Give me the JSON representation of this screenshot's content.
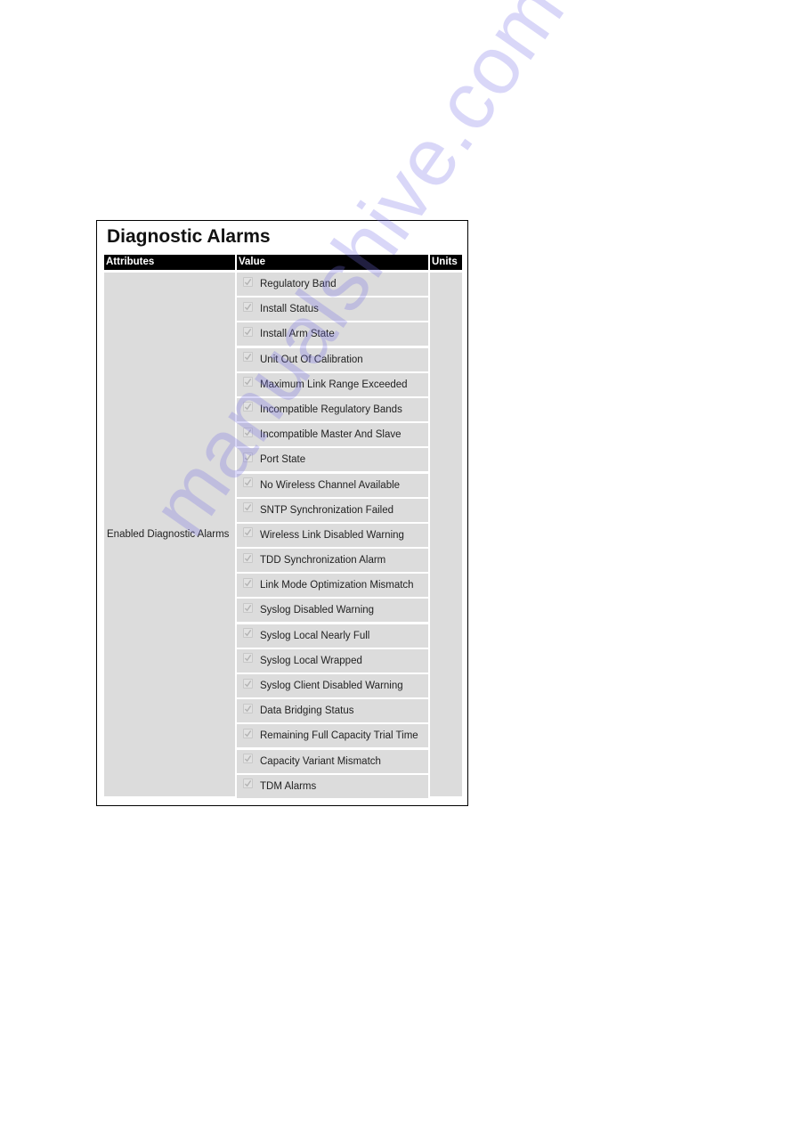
{
  "panel": {
    "title": "Diagnostic Alarms",
    "columns": {
      "attributes": "Attributes",
      "value": "Value",
      "units": "Units"
    },
    "attribute_label": "Enabled Diagnostic Alarms",
    "alarms": [
      {
        "label": "Regulatory Band",
        "checked": true,
        "disabled": true
      },
      {
        "label": "Install Status",
        "checked": true,
        "disabled": true
      },
      {
        "label": "Install Arm State",
        "checked": true,
        "disabled": true
      },
      {
        "label": "Unit Out Of Calibration",
        "checked": true,
        "disabled": true
      },
      {
        "label": "Maximum Link Range Exceeded",
        "checked": true,
        "disabled": true
      },
      {
        "label": "Incompatible Regulatory Bands",
        "checked": true,
        "disabled": true
      },
      {
        "label": "Incompatible Master And Slave",
        "checked": true,
        "disabled": true
      },
      {
        "label": "Port State",
        "checked": true,
        "disabled": true
      },
      {
        "label": "No Wireless Channel Available",
        "checked": true,
        "disabled": true
      },
      {
        "label": "SNTP Synchronization Failed",
        "checked": true,
        "disabled": true
      },
      {
        "label": "Wireless Link Disabled Warning",
        "checked": true,
        "disabled": true
      },
      {
        "label": "TDD Synchronization Alarm",
        "checked": true,
        "disabled": true
      },
      {
        "label": "Link Mode Optimization Mismatch",
        "checked": true,
        "disabled": true
      },
      {
        "label": "Syslog Disabled Warning",
        "checked": true,
        "disabled": true
      },
      {
        "label": "Syslog Local Nearly Full",
        "checked": true,
        "disabled": true
      },
      {
        "label": "Syslog Local Wrapped",
        "checked": true,
        "disabled": true
      },
      {
        "label": "Syslog Client Disabled Warning",
        "checked": true,
        "disabled": true
      },
      {
        "label": "Data Bridging Status",
        "checked": true,
        "disabled": true
      },
      {
        "label": "Remaining Full Capacity Trial Time",
        "checked": true,
        "disabled": true
      },
      {
        "label": "Capacity Variant Mismatch",
        "checked": true,
        "disabled": true
      },
      {
        "label": "TDM Alarms",
        "checked": true,
        "disabled": true
      }
    ]
  },
  "watermark": "manualshive.com",
  "colors": {
    "header_bg": "#000000",
    "header_text": "#ffffff",
    "cell_bg": "#dcdcdc",
    "checkmark": "#b4b4b4"
  }
}
